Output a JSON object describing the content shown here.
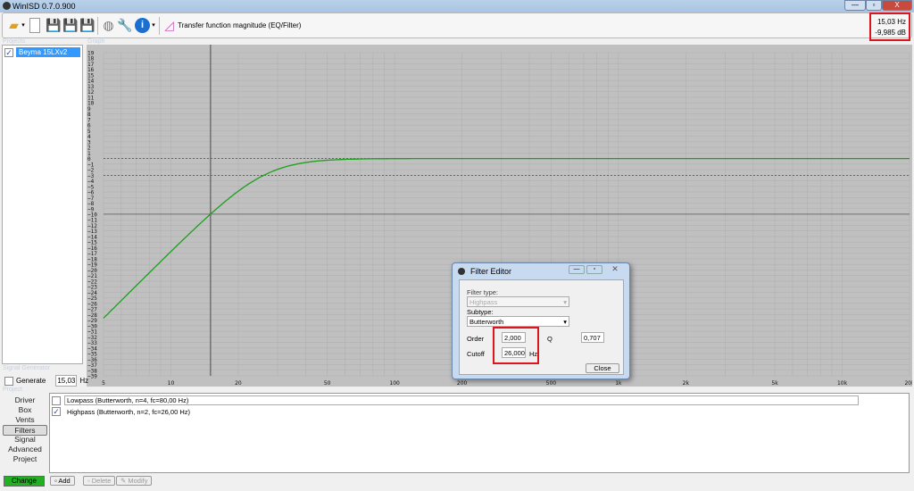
{
  "window": {
    "title": "WinISD 0.7.0.900",
    "minimize": "—",
    "maximize": "▫",
    "close": "X"
  },
  "toolbar": {
    "view_label": "Transfer function magnitude (EQ/Filter)"
  },
  "readout": {
    "freq": "15,03 Hz",
    "level": "-9,985 dB"
  },
  "projects": {
    "label": "Projects",
    "items": [
      {
        "name": "Beyma 15LXv2",
        "checked": true
      }
    ]
  },
  "graph": {
    "label": "Graph"
  },
  "signal_generator": {
    "label": "Signal Generator",
    "generate_label": "Generate",
    "value": "15,03",
    "unit": "Hz"
  },
  "project_nav": {
    "label": "Project",
    "items": [
      "Driver",
      "Box",
      "Vents",
      "Filters",
      "Signal",
      "Advanced",
      "Project"
    ],
    "selected": "Filters",
    "change_label": "Change"
  },
  "filters": {
    "items": [
      {
        "label": "Lowpass (Butterworth, n=4, fc=80,00 Hz)",
        "checked": false
      },
      {
        "label": "Highpass (Butterworth, n=2, fc=26,00 Hz)",
        "checked": true
      }
    ],
    "add": "Add",
    "delete": "Delete",
    "modify": "Modify"
  },
  "filter_editor": {
    "title": "Filter Editor",
    "filter_type_label": "Filter type:",
    "filter_type": "Highpass",
    "subtype_label": "Subtype:",
    "subtype": "Butterworth",
    "order_label": "Order",
    "order": "2,000",
    "q_label": "Q",
    "q": "0,707",
    "cutoff_label": "Cutoff",
    "cutoff": "26,000",
    "cutoff_unit": "Hz",
    "close": "Close"
  },
  "chart_data": {
    "type": "line",
    "title": "Transfer function magnitude (EQ/Filter)",
    "xscale": "log",
    "xlim": [
      5,
      20000
    ],
    "ylim": [
      -39,
      19
    ],
    "xticks": [
      "5",
      "10",
      "20",
      "50",
      "100",
      "200",
      "500",
      "1k",
      "2k",
      "5k",
      "10k",
      "20k"
    ],
    "xtick_values": [
      5,
      10,
      20,
      50,
      100,
      200,
      500,
      1000,
      2000,
      5000,
      10000,
      20000
    ],
    "series": [
      {
        "name": "Beyma 15LXv2",
        "model": "2nd-order Butterworth highpass",
        "fc": 26,
        "order": 2,
        "color": "#1aa01a"
      }
    ],
    "reference_lines": [
      0,
      -3
    ],
    "cursor": {
      "x": 15.03,
      "y": -9.985
    }
  }
}
